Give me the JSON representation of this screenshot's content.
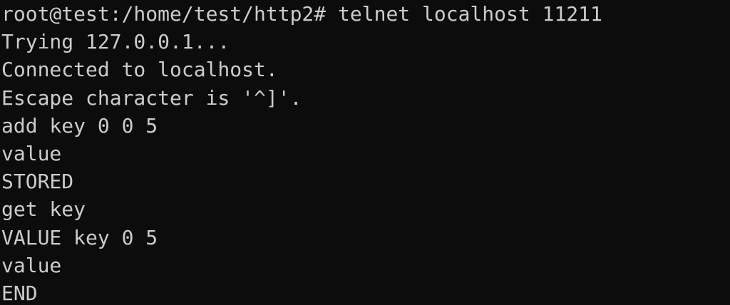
{
  "terminal": {
    "lines": [
      "root@test:/home/test/http2# telnet localhost 11211",
      "Trying 127.0.0.1...",
      "Connected to localhost.",
      "Escape character is '^]'.",
      "add key 0 0 5",
      "value",
      "STORED",
      "get key",
      "VALUE key 0 5",
      "value",
      "END"
    ]
  },
  "colors": {
    "background": "#0c0c0c",
    "text": "#cccccc"
  }
}
